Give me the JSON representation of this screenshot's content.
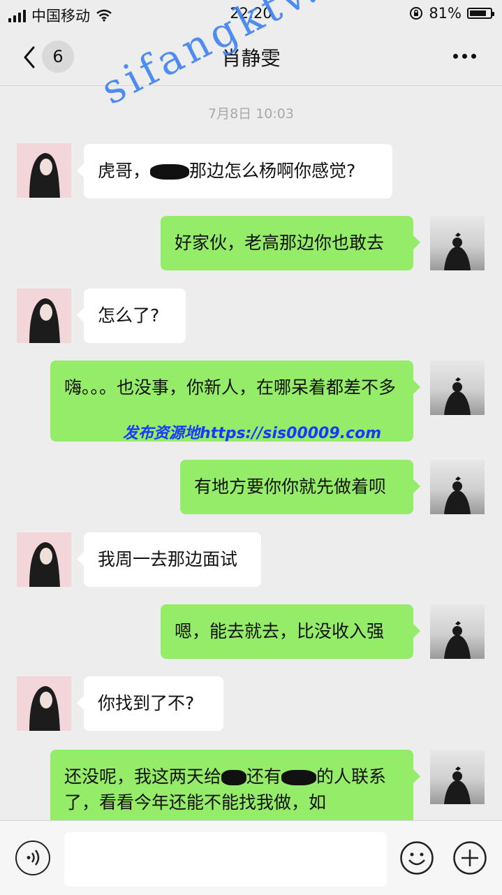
{
  "status_bar": {
    "carrier": "中国移动",
    "time": "22:20",
    "battery": "81%",
    "battery_level": 0.81
  },
  "nav": {
    "back_count": "6",
    "title": "肖静雯"
  },
  "timestamp": "7月8日 10:03",
  "messages": [
    {
      "side": "left",
      "text": "虎哥，",
      "text_after": "那边怎么杨啊你感觉?"
    },
    {
      "side": "right",
      "text": "好家伙，老高那边你也敢去"
    },
    {
      "side": "left",
      "text": "怎么了?"
    },
    {
      "side": "right",
      "text": "嗨。。。也没事，你新人，在哪呆着都差不多"
    },
    {
      "side": "right",
      "text": "有地方要你你就先做着呗"
    },
    {
      "side": "left",
      "text": "我周一去那边面试"
    },
    {
      "side": "right",
      "text": "嗯，能去就去，比没收入强"
    },
    {
      "side": "left",
      "text": "你找到了不?"
    },
    {
      "side": "right",
      "text": "还没呢，我这两天给",
      "text_mid": "还有",
      "text_after": "的人联系了，看看今年还能不能找我做，如"
    }
  ],
  "overlays": {
    "watermark": "sifangktv.com",
    "blue_note": "发布资源地https://sis00009.com"
  },
  "icons": {
    "back": "chevron-left-icon",
    "more": "more-dots-icon",
    "voice": "voice-icon",
    "emoji": "emoji-icon",
    "plus": "plus-icon",
    "signal": "signal-icon",
    "wifi": "wifi-icon",
    "lock": "rotation-lock-icon",
    "battery": "battery-icon"
  },
  "colors": {
    "background": "#ededed",
    "bubble_right": "#95ec69",
    "bubble_left": "#ffffff",
    "watermark": "#3f82f0",
    "blue_note": "#1a37ff"
  }
}
